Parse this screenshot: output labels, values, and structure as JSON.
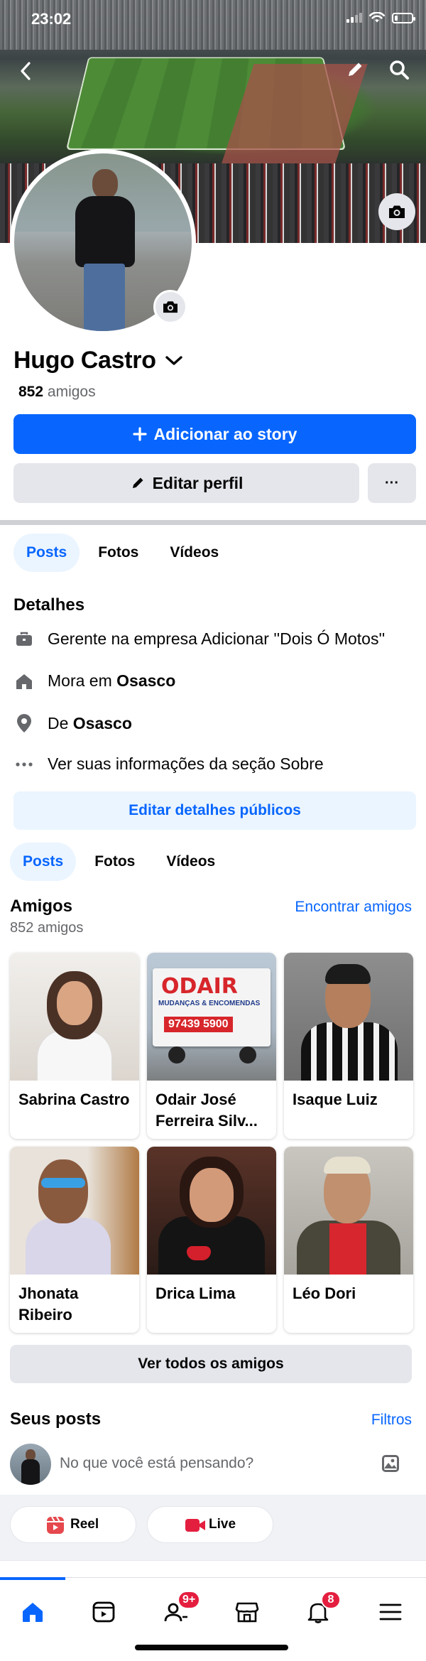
{
  "status_bar": {
    "time": "23:02",
    "battery_level": 0.2
  },
  "profile": {
    "name": "Hugo Castro",
    "friends_count": "852",
    "friends_label": "amigos"
  },
  "actions": {
    "add_story": "Adicionar ao story",
    "edit_profile": "Editar perfil",
    "more": "···"
  },
  "tabs": [
    "Posts",
    "Fotos",
    "Vídeos"
  ],
  "details": {
    "title": "Detalhes",
    "work": "Gerente na empresa Adicionar ''Dois Ó Motos''",
    "lives_prefix": "Mora em ",
    "lives_city": "Osasco",
    "from_prefix": "De ",
    "from_city": "Osasco",
    "about": "Ver suas informações da seção Sobre",
    "edit_button": "Editar detalhes públicos"
  },
  "friends": {
    "title": "Amigos",
    "find_link": "Encontrar amigos",
    "count_text": "852 amigos",
    "list": [
      {
        "name": "Sabrina Castro"
      },
      {
        "name": "Odair José Ferreira Silv..."
      },
      {
        "name": "Isaque Luiz"
      },
      {
        "name": "Jhonata Ribeiro"
      },
      {
        "name": "Drica Lima"
      },
      {
        "name": "Léo Dori"
      }
    ],
    "truck_sign": "ODAIR",
    "truck_sub": "MUDANÇAS & ENCOMENDAS",
    "truck_phone": "97439 5900",
    "see_all": "Ver todos os amigos"
  },
  "posts": {
    "title": "Seus posts",
    "filters_link": "Filtros",
    "composer_placeholder": "No que você está pensando?",
    "reel_label": "Reel",
    "live_label": "Live"
  },
  "bottom_nav": {
    "friends_badge": "9+",
    "notifications_badge": "8"
  },
  "colors": {
    "accent": "#0866ff",
    "badge": "#e41e3f"
  }
}
